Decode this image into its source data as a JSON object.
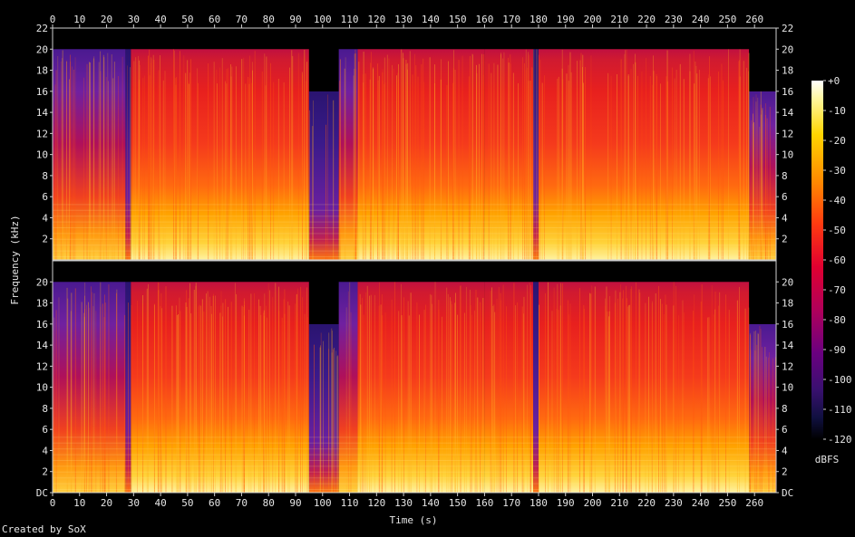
{
  "chart_data": {
    "type": "heatmap",
    "title": "",
    "xlabel": "Time (s)",
    "ylabel": "Frequency (kHz)",
    "xlim": [
      0,
      268
    ],
    "ylim": [
      0,
      22
    ],
    "x_ticks": [
      "0",
      "10",
      "20",
      "30",
      "40",
      "50",
      "60",
      "70",
      "80",
      "90",
      "100",
      "110",
      "120",
      "130",
      "140",
      "150",
      "160",
      "170",
      "180",
      "190",
      "200",
      "210",
      "220",
      "230",
      "240",
      "250",
      "260"
    ],
    "y_ticks_top": [
      "2",
      "4",
      "6",
      "8",
      "10",
      "12",
      "14",
      "16",
      "18",
      "20",
      "22"
    ],
    "y_ticks_bottom": [
      "DC",
      "2",
      "4",
      "6",
      "8",
      "10",
      "12",
      "14",
      "16",
      "18",
      "20"
    ],
    "channels": [
      "channel 1",
      "channel 2"
    ],
    "colorbar": {
      "label": "dBFS",
      "ticks": [
        "+0",
        "-10",
        "-20",
        "-30",
        "-40",
        "-50",
        "-60",
        "-70",
        "-80",
        "-90",
        "-100",
        "-110",
        "-120"
      ],
      "range": [
        -120,
        0
      ]
    },
    "sections": [
      {
        "t0": 0,
        "t1": 27,
        "cutoff_khz": 20,
        "level": "medium"
      },
      {
        "t0": 27,
        "t1": 29,
        "cutoff_khz": 20,
        "level": "low"
      },
      {
        "t0": 29,
        "t1": 95,
        "cutoff_khz": 20,
        "level": "high"
      },
      {
        "t0": 95,
        "t1": 106,
        "cutoff_khz": 16,
        "level": "low"
      },
      {
        "t0": 106,
        "t1": 113,
        "cutoff_khz": 20,
        "level": "medium"
      },
      {
        "t0": 113,
        "t1": 160,
        "cutoff_khz": 20,
        "level": "high"
      },
      {
        "t0": 160,
        "t1": 178,
        "cutoff_khz": 20,
        "level": "high"
      },
      {
        "t0": 178,
        "t1": 180,
        "cutoff_khz": 20,
        "level": "low"
      },
      {
        "t0": 180,
        "t1": 258,
        "cutoff_khz": 20,
        "level": "high"
      },
      {
        "t0": 258,
        "t1": 268,
        "cutoff_khz": 16,
        "level": "medium"
      }
    ]
  },
  "footer": {
    "credit": "Created by SoX"
  },
  "colors": {
    "background": "#000000",
    "axis": "#cfcfcf",
    "high": "#ff2a1a",
    "low": "#3a1a8a",
    "bright": "#ffe060"
  }
}
